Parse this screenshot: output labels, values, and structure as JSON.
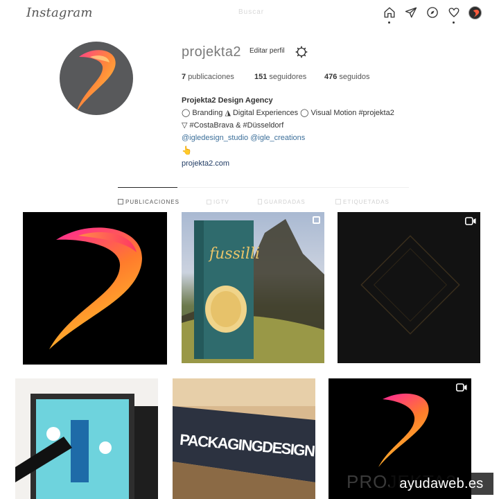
{
  "app": {
    "logo": "Instagram",
    "search_placeholder": "Buscar"
  },
  "nav": {
    "icons": [
      "home-icon",
      "direct-icon",
      "explore-icon",
      "activity-heart-icon",
      "profile-avatar"
    ]
  },
  "profile": {
    "username": "projekta2",
    "edit_label": "Editar perfil",
    "stats": {
      "posts_num": "7",
      "posts_label": "publicaciones",
      "followers_num": "151",
      "followers_label": "seguidores",
      "following_num": "476",
      "following_label": "seguidos"
    },
    "bio": {
      "name": "Projekta2 Design Agency",
      "line1": "◯ Branding ◮ Digital Experiences ◯ Visual Motion #projekta2",
      "line2": "▽ #CostaBrava & #Düsseldorf",
      "mentions": "@igledesign_studio @igle_creations",
      "emoji": "👆",
      "website": "projekta2.com"
    }
  },
  "tabs": [
    {
      "label": "PUBLICACIONES",
      "active": true
    },
    {
      "label": "IGTV",
      "active": false
    },
    {
      "label": "GUARDADAS",
      "active": false
    },
    {
      "label": "ETIQUETADAS",
      "active": false
    }
  ],
  "posts": [
    {
      "kind": "logo-mark"
    },
    {
      "kind": "fussilli-pasta-box",
      "text": "fussilli"
    },
    {
      "kind": "dark-diamond-video"
    },
    {
      "kind": "poster-illustration"
    },
    {
      "kind": "packaging-design",
      "text": "PACKAGINGDESIGN"
    },
    {
      "kind": "logo-video",
      "text": "PROJEKTA2"
    }
  ],
  "watermark": "ayudaweb.es"
}
